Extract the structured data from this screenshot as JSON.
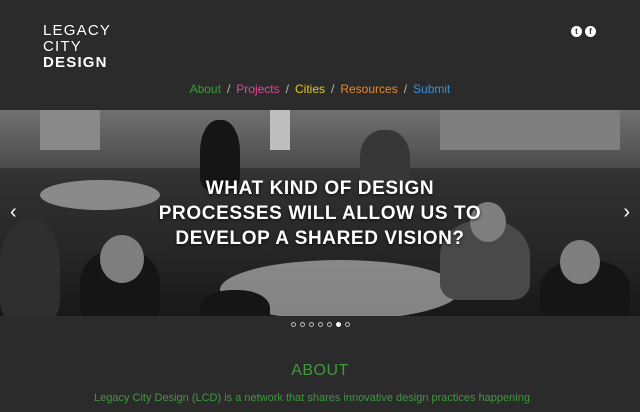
{
  "logo": {
    "line1": "LEGACY",
    "line2": "CITY",
    "line3": "DESIGN"
  },
  "social": [
    {
      "icon": "twitter-icon",
      "glyph": "t"
    },
    {
      "icon": "facebook-icon",
      "glyph": "f"
    }
  ],
  "nav": {
    "items": [
      {
        "label": "About",
        "color": "#3c9a3c"
      },
      {
        "label": "Projects",
        "color": "#e0479a"
      },
      {
        "label": "Cities",
        "color": "#e6c619"
      },
      {
        "label": "Resources",
        "color": "#e88a2a"
      },
      {
        "label": "Submit",
        "color": "#3a8fd8"
      }
    ],
    "separator": "/"
  },
  "hero": {
    "line1": "WHAT KIND OF DESIGN",
    "line2": "PROCESSES WILL ALLOW US TO",
    "line3": "DEVELOP A SHARED VISION?",
    "prev_glyph": "‹",
    "next_glyph": "›"
  },
  "carousel": {
    "count": 7,
    "active_index": 5
  },
  "about": {
    "title": "ABOUT",
    "text": "Legacy City Design (LCD) is a network that shares innovative design practices happening"
  }
}
